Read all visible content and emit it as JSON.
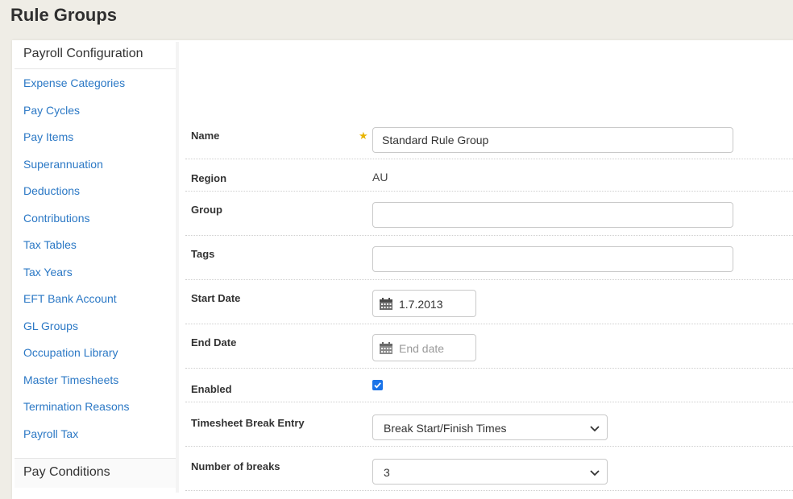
{
  "page": {
    "title": "Rule Groups"
  },
  "sidebar": {
    "heading": "Payroll Configuration",
    "items": [
      "Expense Categories",
      "Pay Cycles",
      "Pay Items",
      "Superannuation",
      "Deductions",
      "Contributions",
      "Tax Tables",
      "Tax Years",
      "EFT Bank Account",
      "GL Groups",
      "Occupation Library",
      "Master Timesheets",
      "Termination Reasons",
      "Payroll Tax"
    ],
    "second_heading": "Pay Conditions"
  },
  "form": {
    "name": {
      "label": "Name",
      "value": "Standard Rule Group",
      "required_marker": "★"
    },
    "region": {
      "label": "Region",
      "value": "AU"
    },
    "group": {
      "label": "Group",
      "value": ""
    },
    "tags": {
      "label": "Tags",
      "value": ""
    },
    "start_date": {
      "label": "Start Date",
      "value": "1.7.2013",
      "icon": "calendar-icon"
    },
    "end_date": {
      "label": "End Date",
      "placeholder": "End date",
      "icon": "calendar-icon"
    },
    "enabled": {
      "label": "Enabled",
      "checked": true
    },
    "break_entry": {
      "label": "Timesheet Break Entry",
      "value": "Break Start/Finish Times"
    },
    "num_breaks": {
      "label": "Number of breaks",
      "value": "3"
    }
  },
  "colors": {
    "link": "#2b78c5",
    "checkbox": "#1a73e8",
    "star": "#e8b400",
    "background": "#efede6"
  }
}
